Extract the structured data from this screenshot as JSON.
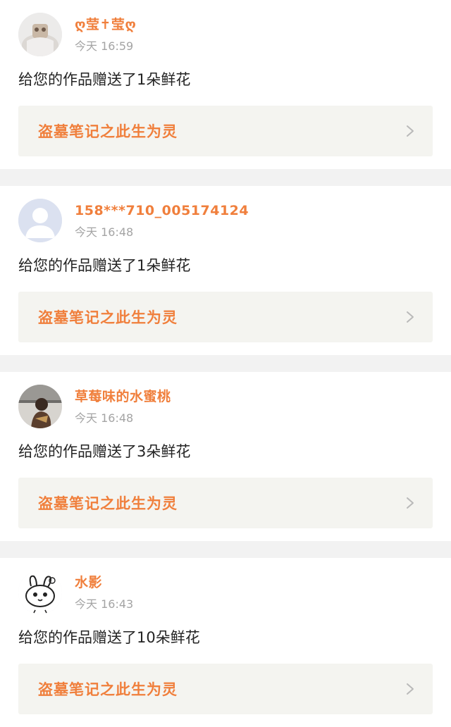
{
  "notifications": [
    {
      "name": "ღ莹✝莹ღ",
      "time": "今天 16:59",
      "message": "给您的作品赠送了1朵鲜花",
      "work_title": "盗墓笔记之此生为灵",
      "avatar": "photo-avatar"
    },
    {
      "name": "158***710_005174124",
      "time": "今天 16:48",
      "message": "给您的作品赠送了1朵鲜花",
      "work_title": "盗墓笔记之此生为灵",
      "avatar": "default-user-avatar"
    },
    {
      "name": "草莓味的水蜜桃",
      "time": "今天 16:48",
      "message": "给您的作品赠送了3朵鲜花",
      "work_title": "盗墓笔记之此生为灵",
      "avatar": "photo-avatar"
    },
    {
      "name": "水影",
      "time": "今天 16:43",
      "message": "给您的作品赠送了10朵鲜花",
      "work_title": "盗墓笔记之此生为灵",
      "avatar": "cartoon-rabbit-avatar"
    }
  ],
  "colors": {
    "accent": "#f07f3c",
    "link_bg": "#f4f4f0",
    "separator": "#f2f2f2"
  }
}
